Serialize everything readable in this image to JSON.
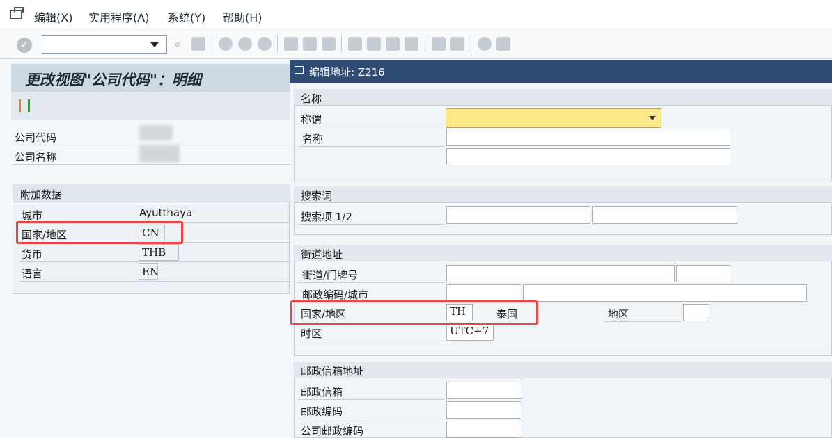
{
  "menu": {
    "edit": "编辑(X)",
    "utilities": "实用程序(A)",
    "system": "系统(Y)",
    "help": "帮助(H)"
  },
  "toolbar": {
    "command_value": ""
  },
  "left_panel": {
    "title": "更改视图\"公司代码\"：明细",
    "company_code_label": "公司代码",
    "company_name_label": "公司名称",
    "additional_group": "附加数据",
    "city_label": "城市",
    "city_value": "Ayutthaya",
    "country_label": "国家/地区",
    "country_value": "CN",
    "currency_label": "货币",
    "currency_value": "THB",
    "language_label": "语言",
    "language_value": "EN"
  },
  "dialog": {
    "title": "编辑地址: Z216",
    "name_group": "名称",
    "salutation_label": "称谓",
    "name_label": "名称",
    "search_group": "搜索词",
    "search_term_label": "搜索项 1/2",
    "street_group": "街道地址",
    "street_label": "街道/门牌号",
    "postal_city_label": "邮政编码/城市",
    "country_label": "国家/地区",
    "country_value": "TH",
    "country_name": "泰国",
    "region_label": "地区",
    "timezone_label": "时区",
    "timezone_value": "UTC+7",
    "po_group": "邮政信箱地址",
    "po_box_label": "邮政信箱",
    "po_postal_label": "邮政编码",
    "company_postal_label": "公司邮政编码"
  },
  "colors": {
    "highlight": "#ef4444",
    "dialog_header": "#2f4b74",
    "required_field": "#fde98a"
  }
}
